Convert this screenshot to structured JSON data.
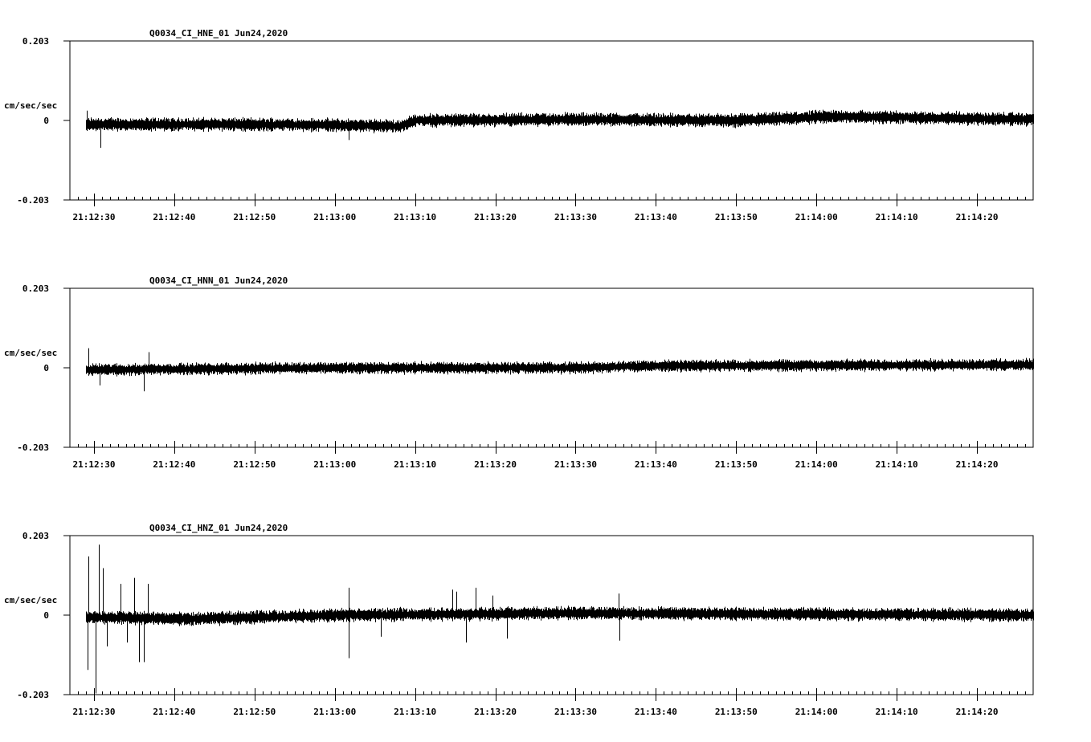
{
  "chart_data": [
    {
      "type": "line",
      "title": "Q0034_CI_HNE_01  Jun24,2020",
      "ylabel": "cm/sec/sec",
      "ylim": [
        -0.203,
        0.203
      ],
      "y_ticks": [
        "0.203",
        "0",
        "-0.203"
      ],
      "x_ticks": [
        "21:12:30",
        "21:12:40",
        "21:12:50",
        "21:13:00",
        "21:13:10",
        "21:13:20",
        "21:13:30",
        "21:13:40",
        "21:13:50",
        "21:14:00",
        "21:14:10",
        "21:14:20"
      ],
      "series": [
        {
          "trace_start": "21:12:29",
          "trace_end": "21:14:27",
          "noise_amplitude": 0.02,
          "baseline": [
            [
              "21:12:29",
              -0.01
            ],
            [
              "21:12:50",
              -0.01
            ],
            [
              "21:13:00",
              -0.012
            ],
            [
              "21:13:08",
              -0.015
            ],
            [
              "21:13:10",
              0.0
            ],
            [
              "21:13:30",
              0.003
            ],
            [
              "21:13:50",
              0.0
            ],
            [
              "21:14:02",
              0.01
            ],
            [
              "21:14:27",
              0.003
            ]
          ],
          "spikes": [
            {
              "time": "21:12:30",
              "value": -0.07
            },
            {
              "time": "21:12:29",
              "value": 0.025
            },
            {
              "time": "21:13:01",
              "value": -0.05
            }
          ]
        }
      ]
    },
    {
      "type": "line",
      "title": "Q0034_CI_HNN_01  Jun24,2020",
      "ylabel": "cm/sec/sec",
      "ylim": [
        -0.203,
        0.203
      ],
      "y_ticks": [
        "0.203",
        "0",
        "-0.203"
      ],
      "x_ticks": [
        "21:12:30",
        "21:12:40",
        "21:12:50",
        "21:13:00",
        "21:13:10",
        "21:13:20",
        "21:13:30",
        "21:13:40",
        "21:13:50",
        "21:14:00",
        "21:14:10",
        "21:14:20"
      ],
      "series": [
        {
          "trace_start": "21:12:29",
          "trace_end": "21:14:27",
          "noise_amplitude": 0.018,
          "baseline": [
            [
              "21:12:29",
              -0.005
            ],
            [
              "21:13:00",
              0.0
            ],
            [
              "21:13:30",
              0.0
            ],
            [
              "21:13:40",
              0.005
            ],
            [
              "21:14:27",
              0.008
            ]
          ],
          "spikes": [
            {
              "time": "21:12:29",
              "value": 0.05
            },
            {
              "time": "21:12:30",
              "value": -0.045
            },
            {
              "time": "21:12:36",
              "value": -0.06
            },
            {
              "time": "21:12:36",
              "value": 0.04
            }
          ]
        }
      ]
    },
    {
      "type": "line",
      "title": "Q0034_CI_HNZ_01  Jun24,2020",
      "ylabel": "cm/sec/sec",
      "ylim": [
        -0.203,
        0.203
      ],
      "y_ticks": [
        "0.203",
        "0",
        "-0.203"
      ],
      "x_ticks": [
        "21:12:30",
        "21:12:40",
        "21:12:50",
        "21:13:00",
        "21:13:10",
        "21:13:20",
        "21:13:30",
        "21:13:40",
        "21:13:50",
        "21:14:00",
        "21:14:10",
        "21:14:20"
      ],
      "series": [
        {
          "trace_start": "21:12:29",
          "trace_end": "21:14:27",
          "noise_amplitude": 0.02,
          "baseline": [
            [
              "21:12:29",
              -0.005
            ],
            [
              "21:12:42",
              -0.01
            ],
            [
              "21:13:00",
              0.0
            ],
            [
              "21:13:30",
              0.005
            ],
            [
              "21:14:27",
              0.0
            ]
          ],
          "spikes": [
            {
              "time": "21:12:29",
              "value": 0.15
            },
            {
              "time": "21:12:29",
              "value": -0.14
            },
            {
              "time": "21:12:30",
              "value": 0.18
            },
            {
              "time": "21:12:30",
              "value": -0.2
            },
            {
              "time": "21:12:31",
              "value": 0.12
            },
            {
              "time": "21:12:31",
              "value": -0.08
            },
            {
              "time": "21:12:33",
              "value": 0.08
            },
            {
              "time": "21:12:34",
              "value": -0.07
            },
            {
              "time": "21:12:35",
              "value": 0.095
            },
            {
              "time": "21:12:35",
              "value": -0.12
            },
            {
              "time": "21:12:36",
              "value": 0.08
            },
            {
              "time": "21:12:36",
              "value": -0.12
            },
            {
              "time": "21:13:01",
              "value": 0.07
            },
            {
              "time": "21:13:01",
              "value": -0.11
            },
            {
              "time": "21:13:05",
              "value": -0.055
            },
            {
              "time": "21:13:14",
              "value": 0.065
            },
            {
              "time": "21:13:15",
              "value": 0.06
            },
            {
              "time": "21:13:16",
              "value": -0.07
            },
            {
              "time": "21:13:17",
              "value": 0.07
            },
            {
              "time": "21:13:19",
              "value": 0.05
            },
            {
              "time": "21:13:21",
              "value": -0.06
            },
            {
              "time": "21:13:35",
              "value": 0.055
            },
            {
              "time": "21:13:35",
              "value": -0.065
            }
          ]
        }
      ]
    }
  ]
}
